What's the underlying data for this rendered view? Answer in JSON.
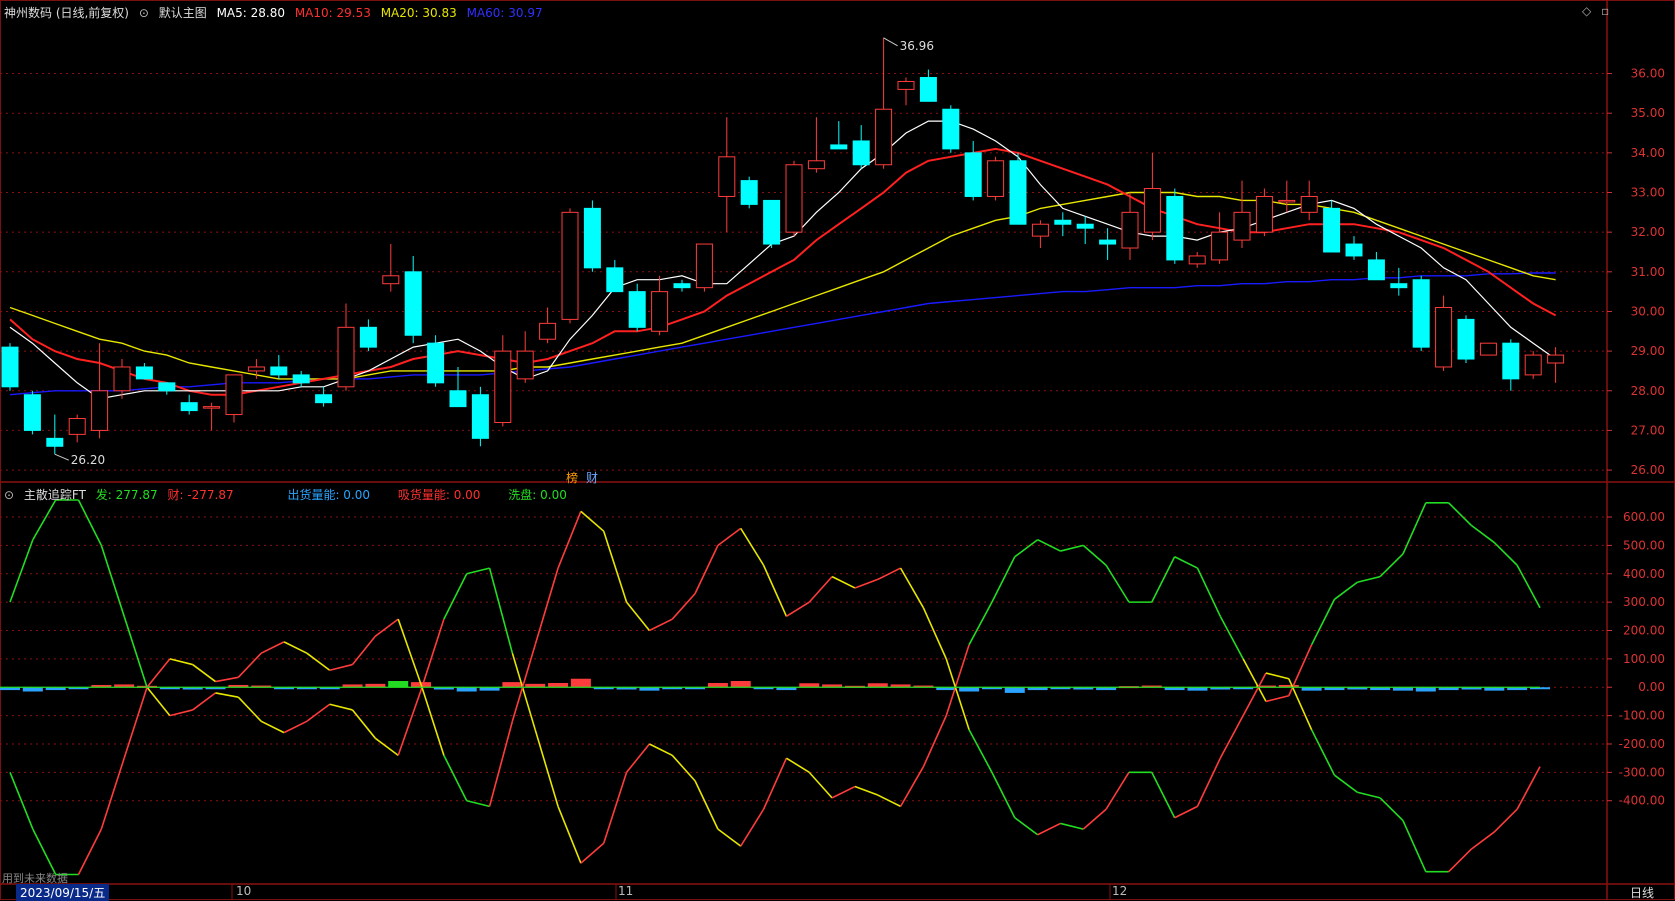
{
  "header": {
    "stock_title": "神州数码 (日线,前复权)",
    "main_chart_label": "默认主图",
    "ma5": "MA5: 28.80",
    "ma10": "MA10: 29.53",
    "ma20": "MA20: 30.83",
    "ma60": "MA60: 30.97"
  },
  "indicator_header": {
    "name": "主散追踪FT",
    "fa": "发: 277.87",
    "cai": "财: -277.87",
    "chuhuo": "出货量能: 0.00",
    "xishou": "吸货量能: 0.00",
    "xipan": "洗盘: 0.00"
  },
  "annotations": {
    "high": "36.96",
    "low": "26.20",
    "tag1": "榜",
    "tag2": "财",
    "future": "用到未来数据"
  },
  "footer": {
    "date": "2023/09/15/五",
    "month_10": "10",
    "month_11": "11",
    "month_12": "12",
    "period": "日线"
  },
  "colors": {
    "up": "#ff3c3c",
    "down": "#00ffff",
    "ma5": "#ffffff",
    "ma10": "#ff2020",
    "ma20": "#e6e600",
    "ma60": "#1a1aff",
    "green": "#22dd22",
    "yellow": "#e6e600",
    "grid": "#8a1010"
  },
  "chart_data": [
    {
      "type": "candlestick",
      "price_ticks": [
        "36.00",
        "35.00",
        "34.00",
        "33.00",
        "32.00",
        "31.00",
        "30.00",
        "29.00",
        "28.00",
        "27.00",
        "26.00"
      ],
      "ylim": [
        25.8,
        37.3
      ],
      "candles": [
        [
          29.1,
          29.2,
          28.0,
          28.1
        ],
        [
          27.9,
          28.0,
          26.9,
          27.0
        ],
        [
          26.8,
          27.4,
          26.4,
          26.6
        ],
        [
          26.9,
          27.4,
          26.7,
          27.3
        ],
        [
          27.0,
          29.2,
          26.8,
          28.0
        ],
        [
          28.0,
          28.8,
          27.8,
          28.6
        ],
        [
          28.6,
          28.7,
          28.3,
          28.3
        ],
        [
          28.2,
          28.2,
          27.9,
          28.0
        ],
        [
          27.7,
          27.9,
          27.4,
          27.5
        ],
        [
          27.6,
          27.7,
          27.0,
          27.6
        ],
        [
          27.4,
          28.4,
          27.2,
          28.4
        ],
        [
          28.5,
          28.8,
          28.3,
          28.6
        ],
        [
          28.6,
          28.9,
          28.3,
          28.4
        ],
        [
          28.4,
          28.5,
          28.1,
          28.2
        ],
        [
          27.9,
          28.1,
          27.6,
          27.7
        ],
        [
          28.1,
          30.2,
          28.0,
          29.6
        ],
        [
          29.6,
          29.8,
          29.0,
          29.1
        ],
        [
          30.7,
          31.7,
          30.5,
          30.9
        ],
        [
          31.0,
          31.4,
          29.2,
          29.4
        ],
        [
          29.2,
          29.4,
          28.1,
          28.2
        ],
        [
          28.0,
          28.6,
          27.6,
          27.6
        ],
        [
          27.9,
          28.1,
          26.6,
          26.8
        ],
        [
          27.2,
          29.4,
          27.1,
          29.0
        ],
        [
          28.3,
          29.5,
          28.2,
          29.0
        ],
        [
          29.3,
          30.1,
          29.2,
          29.7
        ],
        [
          29.8,
          32.6,
          29.7,
          32.5
        ],
        [
          32.6,
          32.8,
          31.0,
          31.1
        ],
        [
          31.1,
          31.3,
          30.5,
          30.5
        ],
        [
          30.5,
          30.7,
          29.5,
          29.6
        ],
        [
          29.5,
          30.9,
          29.4,
          30.5
        ],
        [
          30.7,
          30.8,
          30.5,
          30.6
        ],
        [
          30.6,
          31.7,
          30.5,
          31.7
        ],
        [
          32.9,
          34.9,
          32.0,
          33.9
        ],
        [
          33.3,
          33.4,
          32.6,
          32.7
        ],
        [
          32.8,
          32.8,
          31.6,
          31.7
        ],
        [
          32.0,
          33.8,
          31.9,
          33.7
        ],
        [
          33.6,
          34.9,
          33.5,
          33.8
        ],
        [
          34.2,
          34.8,
          34.1,
          34.1
        ],
        [
          34.3,
          34.7,
          33.6,
          33.7
        ],
        [
          33.7,
          36.9,
          33.6,
          35.1
        ],
        [
          35.6,
          35.9,
          35.2,
          35.8
        ],
        [
          35.9,
          36.1,
          35.4,
          35.3
        ],
        [
          35.1,
          35.2,
          34.0,
          34.1
        ],
        [
          34.0,
          34.3,
          32.8,
          32.9
        ],
        [
          32.9,
          33.9,
          32.8,
          33.8
        ],
        [
          33.8,
          34.0,
          32.6,
          32.2
        ],
        [
          31.9,
          32.3,
          31.6,
          32.2
        ],
        [
          32.3,
          32.5,
          31.9,
          32.2
        ],
        [
          32.2,
          32.4,
          31.7,
          32.1
        ],
        [
          31.8,
          32.1,
          31.3,
          31.7
        ],
        [
          31.6,
          33.0,
          31.3,
          32.5
        ],
        [
          32.0,
          34.0,
          31.8,
          33.1
        ],
        [
          32.9,
          33.1,
          31.2,
          31.3
        ],
        [
          31.2,
          31.5,
          31.1,
          31.4
        ],
        [
          31.3,
          32.5,
          31.2,
          32.0
        ],
        [
          31.8,
          33.3,
          31.6,
          32.5
        ],
        [
          32.0,
          33.1,
          31.9,
          32.9
        ],
        [
          32.8,
          33.3,
          32.5,
          32.8
        ],
        [
          32.5,
          33.3,
          32.3,
          32.9
        ],
        [
          32.6,
          32.8,
          31.5,
          31.5
        ],
        [
          31.7,
          31.9,
          31.3,
          31.4
        ],
        [
          31.3,
          31.5,
          30.8,
          30.8
        ],
        [
          30.7,
          31.1,
          30.4,
          30.6
        ],
        [
          30.8,
          30.9,
          29.0,
          29.1
        ],
        [
          28.6,
          30.4,
          28.5,
          30.1
        ],
        [
          29.8,
          29.9,
          28.7,
          28.8
        ],
        [
          28.9,
          29.2,
          28.9,
          29.2
        ],
        [
          29.2,
          29.3,
          28.0,
          28.3
        ],
        [
          28.4,
          29.0,
          28.3,
          28.9
        ],
        [
          28.7,
          29.1,
          28.2,
          28.9
        ]
      ],
      "ma5": [
        29.6,
        29.2,
        28.7,
        28.2,
        27.8,
        27.9,
        28.0,
        28.0,
        28.0,
        28.0,
        28.0,
        28.0,
        28.0,
        28.1,
        28.1,
        28.3,
        28.5,
        28.8,
        29.1,
        29.2,
        29.3,
        29.0,
        28.6,
        28.3,
        28.5,
        29.3,
        29.9,
        30.6,
        30.8,
        30.8,
        30.9,
        30.7,
        30.7,
        31.2,
        31.7,
        31.9,
        32.5,
        33.0,
        33.6,
        34.0,
        34.5,
        34.8,
        34.8,
        34.6,
        34.3,
        33.9,
        33.2,
        32.6,
        32.4,
        32.2,
        32.0,
        31.9,
        31.9,
        31.8,
        32.0,
        32.1,
        32.3,
        32.5,
        32.7,
        32.8,
        32.6,
        32.2,
        31.9,
        31.6,
        31.1,
        30.8,
        30.2,
        29.6,
        29.2,
        28.8
      ],
      "ma10": [
        29.8,
        29.3,
        29.0,
        28.8,
        28.7,
        28.5,
        28.3,
        28.2,
        28.0,
        27.9,
        27.9,
        28.0,
        28.1,
        28.2,
        28.3,
        28.4,
        28.5,
        28.6,
        28.8,
        28.9,
        29.0,
        28.9,
        28.8,
        28.7,
        28.8,
        29.0,
        29.2,
        29.5,
        29.5,
        29.6,
        29.8,
        30.0,
        30.4,
        30.7,
        31.0,
        31.3,
        31.8,
        32.2,
        32.6,
        33.0,
        33.5,
        33.8,
        33.9,
        34.0,
        34.1,
        34.0,
        33.8,
        33.6,
        33.4,
        33.2,
        32.9,
        32.6,
        32.4,
        32.2,
        32.1,
        32.0,
        32.0,
        32.1,
        32.2,
        32.2,
        32.2,
        32.1,
        32.0,
        31.8,
        31.6,
        31.3,
        31.0,
        30.6,
        30.2,
        29.9
      ],
      "ma20": [
        30.1,
        29.9,
        29.7,
        29.5,
        29.3,
        29.2,
        29.0,
        28.9,
        28.7,
        28.6,
        28.5,
        28.4,
        28.3,
        28.3,
        28.3,
        28.3,
        28.4,
        28.5,
        28.5,
        28.5,
        28.5,
        28.5,
        28.5,
        28.6,
        28.6,
        28.7,
        28.8,
        28.9,
        29.0,
        29.1,
        29.2,
        29.4,
        29.6,
        29.8,
        30.0,
        30.2,
        30.4,
        30.6,
        30.8,
        31.0,
        31.3,
        31.6,
        31.9,
        32.1,
        32.3,
        32.4,
        32.6,
        32.7,
        32.8,
        32.9,
        33.0,
        33.0,
        33.0,
        32.9,
        32.9,
        32.8,
        32.8,
        32.7,
        32.7,
        32.6,
        32.5,
        32.3,
        32.1,
        31.9,
        31.7,
        31.5,
        31.3,
        31.1,
        30.9,
        30.8
      ],
      "ma60": [
        27.9,
        27.95,
        28.0,
        28.0,
        28.0,
        28.0,
        28.05,
        28.1,
        28.1,
        28.15,
        28.2,
        28.2,
        28.2,
        28.25,
        28.3,
        28.3,
        28.3,
        28.35,
        28.4,
        28.4,
        28.4,
        28.4,
        28.45,
        28.5,
        28.55,
        28.6,
        28.7,
        28.8,
        28.9,
        29.0,
        29.1,
        29.2,
        29.3,
        29.4,
        29.5,
        29.6,
        29.7,
        29.8,
        29.9,
        30.0,
        30.1,
        30.2,
        30.25,
        30.3,
        30.35,
        30.4,
        30.45,
        30.5,
        30.5,
        30.55,
        30.6,
        30.6,
        30.6,
        30.65,
        30.65,
        30.7,
        30.7,
        30.75,
        30.75,
        30.8,
        30.8,
        30.85,
        30.85,
        30.9,
        30.9,
        30.9,
        30.95,
        30.95,
        30.97,
        30.97
      ]
    },
    {
      "type": "line",
      "ticks": [
        "600.00",
        "500.00",
        "400.00",
        "300.00",
        "200.00",
        "100.00",
        "0.00",
        "-100.00",
        "-200.00",
        "-300.00",
        "-400.00"
      ],
      "ylim": [
        -690,
        660
      ],
      "series": [
        {
          "values": [
            300,
            520,
            660,
            660,
            500,
            250,
            0,
            -100,
            -80,
            -20,
            -35,
            -120,
            -160,
            -120,
            -60,
            -80,
            -180,
            -240,
            -10,
            240,
            400,
            420,
            120,
            -150,
            -420,
            -620,
            -550,
            -300,
            -200,
            -240,
            -330,
            -500,
            -560,
            -430,
            -250,
            -300,
            -390,
            -350,
            -380,
            -420,
            -280,
            -100,
            150,
            300,
            460,
            520,
            480,
            500,
            430,
            300,
            300,
            460,
            420,
            250,
            100,
            -50,
            -30,
            150,
            310,
            370,
            390,
            470,
            650,
            650,
            570,
            510,
            430,
            280
          ]
        },
        {
          "values": [
            -300,
            -500,
            -660,
            -660,
            -500,
            -250,
            0,
            100,
            80,
            20,
            35,
            120,
            160,
            120,
            60,
            80,
            180,
            240,
            10,
            -240,
            -400,
            -420,
            -120,
            150,
            420,
            620,
            550,
            300,
            200,
            240,
            330,
            500,
            560,
            430,
            250,
            300,
            390,
            350,
            380,
            420,
            280,
            100,
            -150,
            -300,
            -460,
            -520,
            -480,
            -500,
            -430,
            -300,
            -300,
            -460,
            -420,
            -250,
            -100,
            50,
            30,
            -150,
            -310,
            -370,
            -390,
            -470,
            -650,
            -650,
            -570,
            -510,
            -430,
            -280
          ]
        },
        {
          "values": [
            -10,
            -15,
            -10,
            0,
            8,
            10,
            5,
            -5,
            -8,
            0,
            8,
            6,
            -3,
            -4,
            -6,
            10,
            12,
            22,
            18,
            -8,
            -15,
            -12,
            18,
            12,
            15,
            30,
            -5,
            -8,
            -12,
            0,
            -6,
            15,
            22,
            0,
            -10,
            14,
            10,
            5,
            14,
            10,
            6,
            -10,
            -15,
            0,
            -20,
            -10,
            -5,
            -8,
            -10,
            4,
            6,
            -10,
            -12,
            -8,
            -5,
            6,
            8,
            -12,
            -10,
            -8,
            -10,
            -12,
            -15,
            -10,
            -8,
            -12,
            -10,
            0
          ]
        }
      ]
    }
  ]
}
